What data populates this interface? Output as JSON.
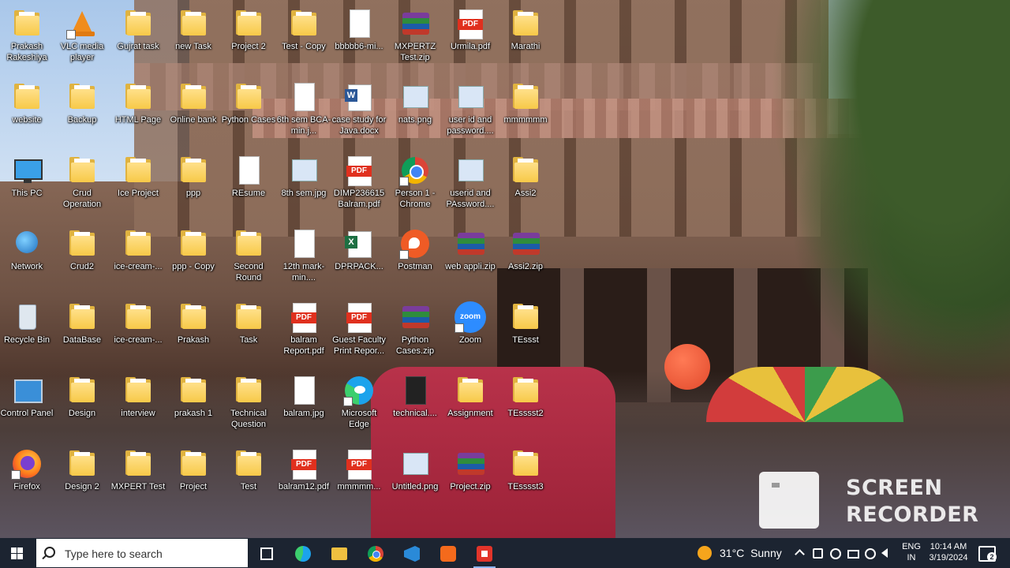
{
  "desktop": {
    "icons": [
      {
        "label": "Prakash Rakeshiya",
        "type": "folder",
        "col": 0,
        "row": 0
      },
      {
        "label": "VLC media player",
        "type": "vlc",
        "col": 1,
        "row": 0,
        "shortcut": true
      },
      {
        "label": "Gujrat task",
        "type": "folder",
        "col": 2,
        "row": 0
      },
      {
        "label": "new Task",
        "type": "chrome-folder",
        "col": 3,
        "row": 0
      },
      {
        "label": "Project 2",
        "type": "folder",
        "col": 4,
        "row": 0
      },
      {
        "label": "Test - Copy",
        "type": "folder",
        "col": 5,
        "row": 0
      },
      {
        "label": "bbbbb6-mi...",
        "type": "doc",
        "col": 6,
        "row": 0
      },
      {
        "label": "MXPERTZ Test.zip",
        "type": "zip",
        "col": 7,
        "row": 0
      },
      {
        "label": "Urmila.pdf",
        "type": "pdf",
        "col": 8,
        "row": 0
      },
      {
        "label": "Marathi",
        "type": "folder",
        "col": 9,
        "row": 0
      },
      {
        "label": "website",
        "type": "folder",
        "col": 0,
        "row": 1
      },
      {
        "label": "Backup",
        "type": "folder",
        "col": 1,
        "row": 1
      },
      {
        "label": "HTML Page",
        "type": "chrome-folder",
        "col": 2,
        "row": 1
      },
      {
        "label": "Online bank",
        "type": "folder",
        "col": 3,
        "row": 1
      },
      {
        "label": "Python Cases",
        "type": "folder",
        "col": 4,
        "row": 1
      },
      {
        "label": "6th sem BCA-min.j...",
        "type": "doc",
        "col": 5,
        "row": 1
      },
      {
        "label": "case study for Java.docx",
        "type": "word",
        "col": 6,
        "row": 1
      },
      {
        "label": "nats.png",
        "type": "img",
        "col": 7,
        "row": 1
      },
      {
        "label": "user id and password....",
        "type": "img",
        "col": 8,
        "row": 1
      },
      {
        "label": "mmmmmm",
        "type": "folder",
        "col": 9,
        "row": 1
      },
      {
        "label": "This PC",
        "type": "pc",
        "col": 0,
        "row": 2
      },
      {
        "label": "Crud Operation",
        "type": "folder",
        "col": 1,
        "row": 2
      },
      {
        "label": "Ice Project",
        "type": "folder",
        "col": 2,
        "row": 2
      },
      {
        "label": "ppp",
        "type": "folder",
        "col": 3,
        "row": 2
      },
      {
        "label": "REsume",
        "type": "doc",
        "col": 4,
        "row": 2
      },
      {
        "label": "8th sem.jpg",
        "type": "img",
        "col": 5,
        "row": 2
      },
      {
        "label": "DIMP236615 Balram.pdf",
        "type": "pdf",
        "col": 6,
        "row": 2
      },
      {
        "label": "Person 1 - Chrome",
        "type": "chrome",
        "col": 7,
        "row": 2,
        "shortcut": true
      },
      {
        "label": "userid and PAssword....",
        "type": "img",
        "col": 8,
        "row": 2
      },
      {
        "label": "Assi2",
        "type": "folder",
        "col": 9,
        "row": 2
      },
      {
        "label": "Network",
        "type": "globe",
        "col": 0,
        "row": 3
      },
      {
        "label": "Crud2",
        "type": "folder",
        "col": 1,
        "row": 3
      },
      {
        "label": "ice-cream-...",
        "type": "chrome-folder",
        "col": 2,
        "row": 3
      },
      {
        "label": "ppp - Copy",
        "type": "folder",
        "col": 3,
        "row": 3
      },
      {
        "label": "Second Round",
        "type": "folder",
        "col": 4,
        "row": 3
      },
      {
        "label": "12th mark-min....",
        "type": "doc",
        "col": 5,
        "row": 3
      },
      {
        "label": "DPRPACK...",
        "type": "excel",
        "col": 6,
        "row": 3
      },
      {
        "label": "Postman",
        "type": "postman",
        "col": 7,
        "row": 3,
        "shortcut": true
      },
      {
        "label": "web appli.zip",
        "type": "zip",
        "col": 8,
        "row": 3
      },
      {
        "label": "Assi2.zip",
        "type": "zip",
        "col": 9,
        "row": 3
      },
      {
        "label": "Recycle Bin",
        "type": "bin",
        "col": 0,
        "row": 4
      },
      {
        "label": "DataBase",
        "type": "folder",
        "col": 1,
        "row": 4
      },
      {
        "label": "ice-cream-...",
        "type": "folder",
        "col": 2,
        "row": 4
      },
      {
        "label": "Prakash",
        "type": "folder",
        "col": 3,
        "row": 4
      },
      {
        "label": "Task",
        "type": "folder",
        "col": 4,
        "row": 4
      },
      {
        "label": "balram Report.pdf",
        "type": "pdf",
        "col": 5,
        "row": 4
      },
      {
        "label": "Guest Faculty Print Repor...",
        "type": "pdf",
        "col": 6,
        "row": 4
      },
      {
        "label": "Python Cases.zip",
        "type": "zip",
        "col": 7,
        "row": 4
      },
      {
        "label": "Zoom",
        "type": "zoom",
        "col": 8,
        "row": 4,
        "shortcut": true
      },
      {
        "label": "TEssst",
        "type": "folder",
        "col": 9,
        "row": 4
      },
      {
        "label": "Control Panel",
        "type": "cpanel",
        "col": 0,
        "row": 5
      },
      {
        "label": "Design",
        "type": "folder",
        "col": 1,
        "row": 5
      },
      {
        "label": "interview",
        "type": "folder",
        "col": 2,
        "row": 5
      },
      {
        "label": "prakash 1",
        "type": "folder",
        "col": 3,
        "row": 5
      },
      {
        "label": "Technical Question",
        "type": "folder",
        "col": 4,
        "row": 5
      },
      {
        "label": "balram.jpg",
        "type": "doc",
        "col": 5,
        "row": 5
      },
      {
        "label": "Microsoft Edge",
        "type": "edge",
        "col": 6,
        "row": 5,
        "shortcut": true
      },
      {
        "label": "technical....",
        "type": "dark-doc",
        "col": 7,
        "row": 5
      },
      {
        "label": "Assignment",
        "type": "folder",
        "col": 8,
        "row": 5
      },
      {
        "label": "TEsssst2",
        "type": "folder",
        "col": 9,
        "row": 5
      },
      {
        "label": "Firefox",
        "type": "firefox",
        "col": 0,
        "row": 6,
        "shortcut": true
      },
      {
        "label": "Design 2",
        "type": "folder",
        "col": 1,
        "row": 6
      },
      {
        "label": "MXPERT Test",
        "type": "folder",
        "col": 2,
        "row": 6
      },
      {
        "label": "Project",
        "type": "folder",
        "col": 3,
        "row": 6
      },
      {
        "label": "Test",
        "type": "folder",
        "col": 4,
        "row": 6
      },
      {
        "label": "balram12.pdf",
        "type": "pdf",
        "col": 5,
        "row": 6
      },
      {
        "label": "mmmmm...",
        "type": "pdf",
        "col": 6,
        "row": 6
      },
      {
        "label": "Untitled.png",
        "type": "img",
        "col": 7,
        "row": 6
      },
      {
        "label": "Project.zip",
        "type": "zip",
        "col": 8,
        "row": 6
      },
      {
        "label": "TEsssst3",
        "type": "folder",
        "col": 9,
        "row": 6
      }
    ],
    "pdf_badge": "PDF",
    "word_badge": "W",
    "excel_badge": "X",
    "zoom_text": "zoom"
  },
  "overlay": {
    "recorder_line1": "SCREEN",
    "recorder_line2": "RECORDER"
  },
  "taskbar": {
    "search_placeholder": "Type here to search",
    "pinned": [
      {
        "name": "task-view-button",
        "icon": "task-view-icon"
      },
      {
        "name": "edge-taskbar-button",
        "icon": "edge-icon"
      },
      {
        "name": "file-explorer-taskbar-button",
        "icon": "folder-icon"
      },
      {
        "name": "chrome-taskbar-button",
        "icon": "chrome-icon"
      },
      {
        "name": "vscode-taskbar-button",
        "icon": "vscode-icon"
      },
      {
        "name": "xampp-taskbar-button",
        "icon": "xampp-icon"
      },
      {
        "name": "screen-recorder-taskbar-button",
        "icon": "recorder-icon",
        "active": true
      }
    ],
    "weather": {
      "temp": "31°C",
      "condition": "Sunny"
    },
    "language": {
      "line1": "ENG",
      "line2": "IN"
    },
    "clock": {
      "time": "10:14 AM",
      "date": "3/19/2024"
    },
    "notification_count": "2"
  }
}
